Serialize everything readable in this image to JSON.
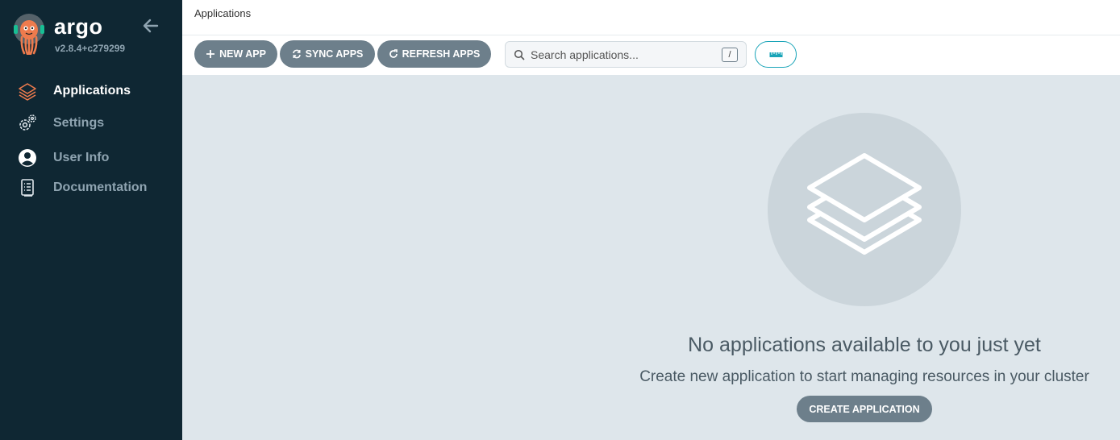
{
  "brand": {
    "name": "argo",
    "version": "v2.8.4+c279299",
    "logo_icon": "argo-octopus-logo"
  },
  "sidebar": {
    "collapse_icon": "arrow-left-icon",
    "items": [
      {
        "label": "Applications",
        "icon": "layers-icon",
        "active": true
      },
      {
        "label": "Settings",
        "icon": "gears-icon",
        "active": false
      },
      {
        "label": "User Info",
        "icon": "user-circle-icon",
        "active": false
      },
      {
        "label": "Documentation",
        "icon": "book-icon",
        "active": false
      }
    ]
  },
  "header": {
    "breadcrumb": "Applications"
  },
  "toolbar": {
    "new_app": "NEW APP",
    "sync_apps": "SYNC APPS",
    "refresh_apps": "REFRESH APPS",
    "search_placeholder": "Search applications...",
    "search_shortcut": "/",
    "view_toggle_icon": "ruler-icon"
  },
  "empty_state": {
    "icon": "layers-icon",
    "title": "No applications available to you just yet",
    "subtitle": "Create new application to start managing resources in your cluster",
    "create_button": "CREATE APPLICATION"
  },
  "colors": {
    "sidebar_bg": "#0f2733",
    "accent_orange": "#ef7b4d",
    "accent_teal": "#19a4b8",
    "button_gray": "#6d7f8b",
    "main_bg": "#dee6eb"
  }
}
